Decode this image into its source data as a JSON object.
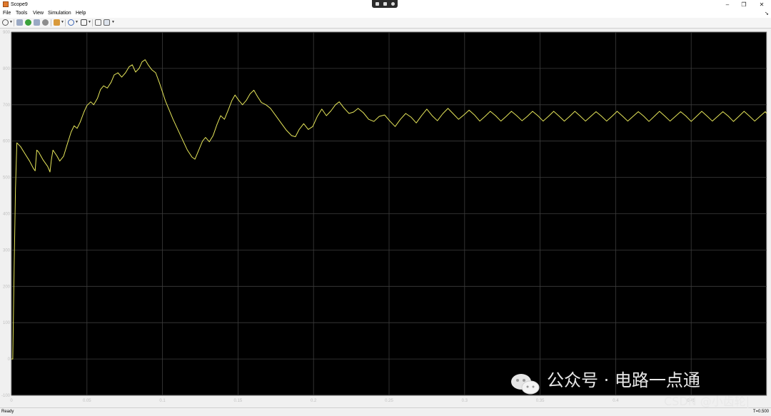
{
  "window": {
    "title": "Scope9"
  },
  "menu": [
    "File",
    "Tools",
    "View",
    "Simulation",
    "Help"
  ],
  "toolbar_icons": [
    "settings-icon",
    "step-back-icon",
    "run-icon",
    "step-forward-icon",
    "stop-icon",
    "highlight-icon",
    "zoom-icon",
    "fit-axes-icon",
    "cursor-measure-icon",
    "style-icon"
  ],
  "status": {
    "text": "Ready",
    "time": "T=0.500"
  },
  "watermark": {
    "line1": "公众号 · 电路一点通",
    "line2": "CSDN @小齿轮|"
  },
  "chart_data": {
    "type": "line",
    "title": "",
    "xlabel": "",
    "ylabel": "",
    "xlim": [
      0,
      0.5
    ],
    "ylim": [
      -100,
      900
    ],
    "grid": true,
    "xticks": [
      0,
      0.05,
      0.1,
      0.15,
      0.2,
      0.25,
      0.3,
      0.35,
      0.4,
      0.45
    ],
    "xtick_labels": [
      "0",
      "0.05",
      "0.1",
      "0.15",
      "0.2",
      "0.25",
      "0.3",
      "0.35",
      "0.4",
      "0.45"
    ],
    "yticks": [
      -100,
      0,
      100,
      200,
      300,
      400,
      500,
      600,
      700,
      800,
      900
    ],
    "ytick_labels": [
      "-100",
      "0",
      "100",
      "200",
      "300",
      "400",
      "500",
      "600",
      "700",
      "800",
      "900"
    ],
    "colors": {
      "background": "#000000",
      "axes": "#c8c8c8",
      "grid": "#3c3c3c",
      "line": "#e6e65a",
      "tick_label": "#bfbfbf"
    },
    "series": [
      {
        "values": [
          [
            0,
            0
          ],
          [
            0.0009,
            0
          ],
          [
            0.0018,
            250
          ],
          [
            0.0027,
            470
          ],
          [
            0.0036,
            595
          ],
          [
            0.006,
            585
          ],
          [
            0.009,
            565
          ],
          [
            0.012,
            545
          ],
          [
            0.0145,
            525
          ],
          [
            0.0157,
            518
          ],
          [
            0.0168,
            575
          ],
          [
            0.018,
            570
          ],
          [
            0.021,
            548
          ],
          [
            0.024,
            530
          ],
          [
            0.0255,
            515
          ],
          [
            0.0265,
            550
          ],
          [
            0.0275,
            575
          ],
          [
            0.03,
            560
          ],
          [
            0.032,
            545
          ],
          [
            0.0345,
            558
          ],
          [
            0.037,
            592
          ],
          [
            0.0395,
            625
          ],
          [
            0.0415,
            642
          ],
          [
            0.0435,
            635
          ],
          [
            0.0455,
            652
          ],
          [
            0.048,
            680
          ],
          [
            0.05,
            698
          ],
          [
            0.0525,
            708
          ],
          [
            0.0545,
            700
          ],
          [
            0.057,
            718
          ],
          [
            0.059,
            742
          ],
          [
            0.061,
            752
          ],
          [
            0.0635,
            746
          ],
          [
            0.066,
            762
          ],
          [
            0.068,
            782
          ],
          [
            0.0705,
            788
          ],
          [
            0.073,
            776
          ],
          [
            0.0755,
            788
          ],
          [
            0.078,
            805
          ],
          [
            0.08,
            810
          ],
          [
            0.0822,
            790
          ],
          [
            0.0845,
            800
          ],
          [
            0.0865,
            818
          ],
          [
            0.0885,
            824
          ],
          [
            0.0905,
            810
          ],
          [
            0.093,
            796
          ],
          [
            0.0955,
            788
          ],
          [
            0.098,
            760
          ],
          [
            0.102,
            710
          ],
          [
            0.107,
            660
          ],
          [
            0.112,
            615
          ],
          [
            0.1165,
            575
          ],
          [
            0.1195,
            556
          ],
          [
            0.1215,
            550
          ],
          [
            0.124,
            575
          ],
          [
            0.1265,
            600
          ],
          [
            0.1285,
            610
          ],
          [
            0.131,
            598
          ],
          [
            0.1335,
            615
          ],
          [
            0.136,
            645
          ],
          [
            0.1385,
            670
          ],
          [
            0.141,
            660
          ],
          [
            0.1435,
            685
          ],
          [
            0.146,
            712
          ],
          [
            0.148,
            727
          ],
          [
            0.1505,
            712
          ],
          [
            0.153,
            700
          ],
          [
            0.1555,
            712
          ],
          [
            0.158,
            730
          ],
          [
            0.1605,
            740
          ],
          [
            0.163,
            722
          ],
          [
            0.1655,
            706
          ],
          [
            0.1685,
            700
          ],
          [
            0.1715,
            690
          ],
          [
            0.175,
            670
          ],
          [
            0.1785,
            650
          ],
          [
            0.182,
            630
          ],
          [
            0.1855,
            615
          ],
          [
            0.188,
            612
          ],
          [
            0.1905,
            632
          ],
          [
            0.1935,
            648
          ],
          [
            0.1965,
            632
          ],
          [
            0.1995,
            640
          ],
          [
            0.2025,
            668
          ],
          [
            0.2055,
            688
          ],
          [
            0.2085,
            670
          ],
          [
            0.2115,
            683
          ],
          [
            0.2145,
            700
          ],
          [
            0.217,
            708
          ],
          [
            0.22,
            692
          ],
          [
            0.2235,
            676
          ],
          [
            0.2265,
            680
          ],
          [
            0.2295,
            690
          ],
          [
            0.233,
            678
          ],
          [
            0.2365,
            660
          ],
          [
            0.24,
            654
          ],
          [
            0.2435,
            668
          ],
          [
            0.247,
            672
          ],
          [
            0.2505,
            655
          ],
          [
            0.254,
            640
          ],
          [
            0.2575,
            660
          ],
          [
            0.261,
            676
          ],
          [
            0.2645,
            666
          ],
          [
            0.268,
            650
          ],
          [
            0.2715,
            670
          ],
          [
            0.275,
            688
          ],
          [
            0.2785,
            670
          ],
          [
            0.282,
            656
          ],
          [
            0.2855,
            675
          ],
          [
            0.289,
            690
          ],
          [
            0.2925,
            675
          ],
          [
            0.296,
            660
          ],
          [
            0.2995,
            672
          ],
          [
            0.303,
            685
          ],
          [
            0.3065,
            672
          ],
          [
            0.31,
            655
          ],
          [
            0.3135,
            668
          ],
          [
            0.317,
            682
          ],
          [
            0.3205,
            670
          ],
          [
            0.324,
            655
          ],
          [
            0.3275,
            668
          ],
          [
            0.331,
            682
          ],
          [
            0.3345,
            670
          ],
          [
            0.338,
            656
          ],
          [
            0.3415,
            668
          ],
          [
            0.345,
            682
          ],
          [
            0.3485,
            670
          ],
          [
            0.352,
            655
          ],
          [
            0.3555,
            668
          ],
          [
            0.359,
            682
          ],
          [
            0.3625,
            669
          ],
          [
            0.366,
            655
          ],
          [
            0.3695,
            668
          ],
          [
            0.373,
            682
          ],
          [
            0.3765,
            669
          ],
          [
            0.38,
            655
          ],
          [
            0.3835,
            668
          ],
          [
            0.387,
            681
          ],
          [
            0.3905,
            669
          ],
          [
            0.394,
            655
          ],
          [
            0.3975,
            668
          ],
          [
            0.401,
            682
          ],
          [
            0.4045,
            669
          ],
          [
            0.408,
            655
          ],
          [
            0.4115,
            668
          ],
          [
            0.415,
            681
          ],
          [
            0.4185,
            669
          ],
          [
            0.422,
            654
          ],
          [
            0.4255,
            668
          ],
          [
            0.429,
            682
          ],
          [
            0.4325,
            669
          ],
          [
            0.436,
            655
          ],
          [
            0.4395,
            668
          ],
          [
            0.443,
            681
          ],
          [
            0.4465,
            669
          ],
          [
            0.45,
            654
          ],
          [
            0.4535,
            668
          ],
          [
            0.457,
            682
          ],
          [
            0.4605,
            669
          ],
          [
            0.464,
            655
          ],
          [
            0.4675,
            668
          ],
          [
            0.471,
            681
          ],
          [
            0.4745,
            669
          ],
          [
            0.478,
            654
          ],
          [
            0.4815,
            668
          ],
          [
            0.485,
            682
          ],
          [
            0.4885,
            669
          ],
          [
            0.492,
            655
          ],
          [
            0.4955,
            668
          ],
          [
            0.499,
            681
          ],
          [
            0.5,
            676
          ]
        ]
      }
    ]
  }
}
